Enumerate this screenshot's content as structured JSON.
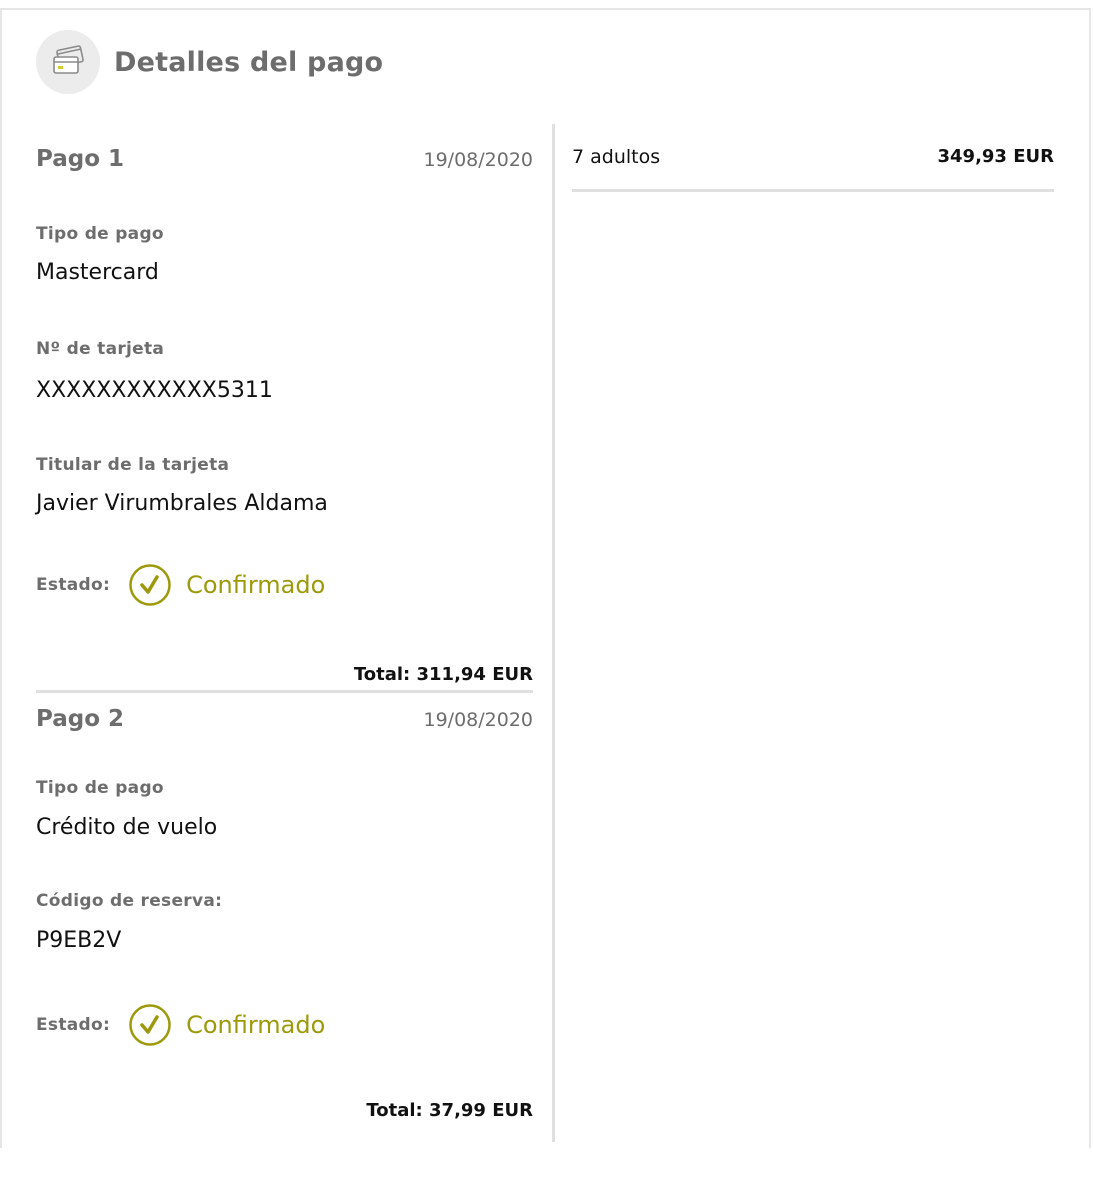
{
  "header": {
    "title": "Detalles del pago",
    "icon": "credit-cards-icon"
  },
  "payments": [
    {
      "title": "Pago 1",
      "date": "19/08/2020",
      "fields": [
        {
          "label": "Tipo de pago",
          "value": "Mastercard"
        },
        {
          "label": "Nº de tarjeta",
          "value": "XXXXXXXXXXXX5311"
        },
        {
          "label": "Titular de la tarjeta",
          "value": "Javier Virumbrales Aldama"
        }
      ],
      "status_label": "Estado:",
      "status_value": "Confirmado",
      "total": "Total: 311,94 EUR"
    },
    {
      "title": "Pago 2",
      "date": "19/08/2020",
      "fields": [
        {
          "label": "Tipo de pago",
          "value": "Crédito de vuelo"
        },
        {
          "label": "Código de reserva:",
          "value": "P9EB2V"
        }
      ],
      "status_label": "Estado:",
      "status_value": "Confirmado",
      "total": "Total: 37,99 EUR"
    }
  ],
  "summary": {
    "passengers": "7 adultos",
    "amount": "349,93 EUR"
  },
  "colors": {
    "accent": "#9c9a0c",
    "label_gray": "#6d6d6d",
    "divider": "#e0e0e0"
  }
}
